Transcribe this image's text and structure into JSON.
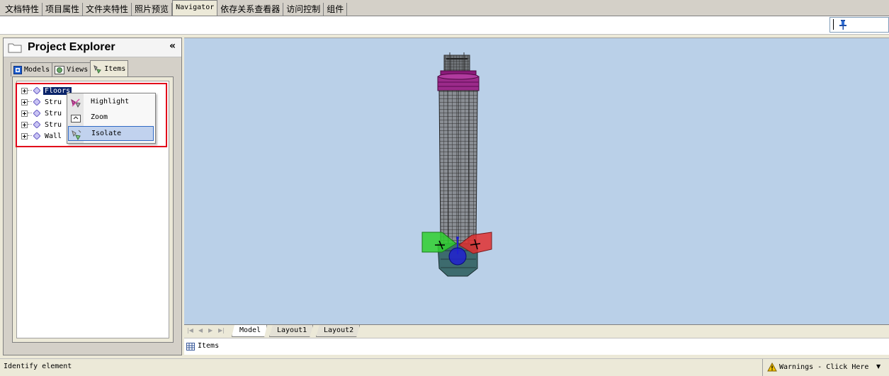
{
  "top_tabs": [
    "文档特性",
    "项目属性",
    "文件夹特性",
    "照片预览",
    "Navigator",
    "依存关系查看器",
    "访问控制",
    "组件"
  ],
  "active_top_tab": "Navigator",
  "explorer": {
    "title": "Project Explorer",
    "collapse_glyph": "«",
    "tabs": [
      {
        "label": "Models",
        "icon": "models-icon"
      },
      {
        "label": "Views",
        "icon": "views-icon"
      },
      {
        "label": "Items",
        "icon": "items-icon"
      }
    ],
    "active_tab": "Items",
    "tree": [
      {
        "label": "Floors",
        "selected": true
      },
      {
        "label": "Stru",
        "selected": false
      },
      {
        "label": "Stru",
        "selected": false
      },
      {
        "label": "Stru",
        "selected": false
      },
      {
        "label": "Wall",
        "selected": false
      }
    ]
  },
  "context_menu": {
    "items": [
      {
        "label": "Highlight",
        "icon": "highlight-icon"
      },
      {
        "label": "Zoom",
        "icon": "zoom-icon"
      },
      {
        "label": "Isolate",
        "icon": "isolate-icon",
        "hovered": true
      }
    ]
  },
  "layout_tabs": [
    "Model",
    "Layout1",
    "Layout2"
  ],
  "active_layout_tab": "Model",
  "bottom_panel": {
    "label": "Items"
  },
  "status": {
    "text": "Identify element",
    "warnings": "Warnings - Click Here"
  },
  "colors": {
    "viewport_bg": "#bad0e8",
    "tower_wire": "#3a3a3a",
    "tower_top": "#8b1a7a",
    "axis_green": "#2fd02f",
    "axis_red": "#e03030",
    "axis_blue": "#2020d0",
    "selection": "#0a246a",
    "red_highlight": "#e2001a"
  }
}
